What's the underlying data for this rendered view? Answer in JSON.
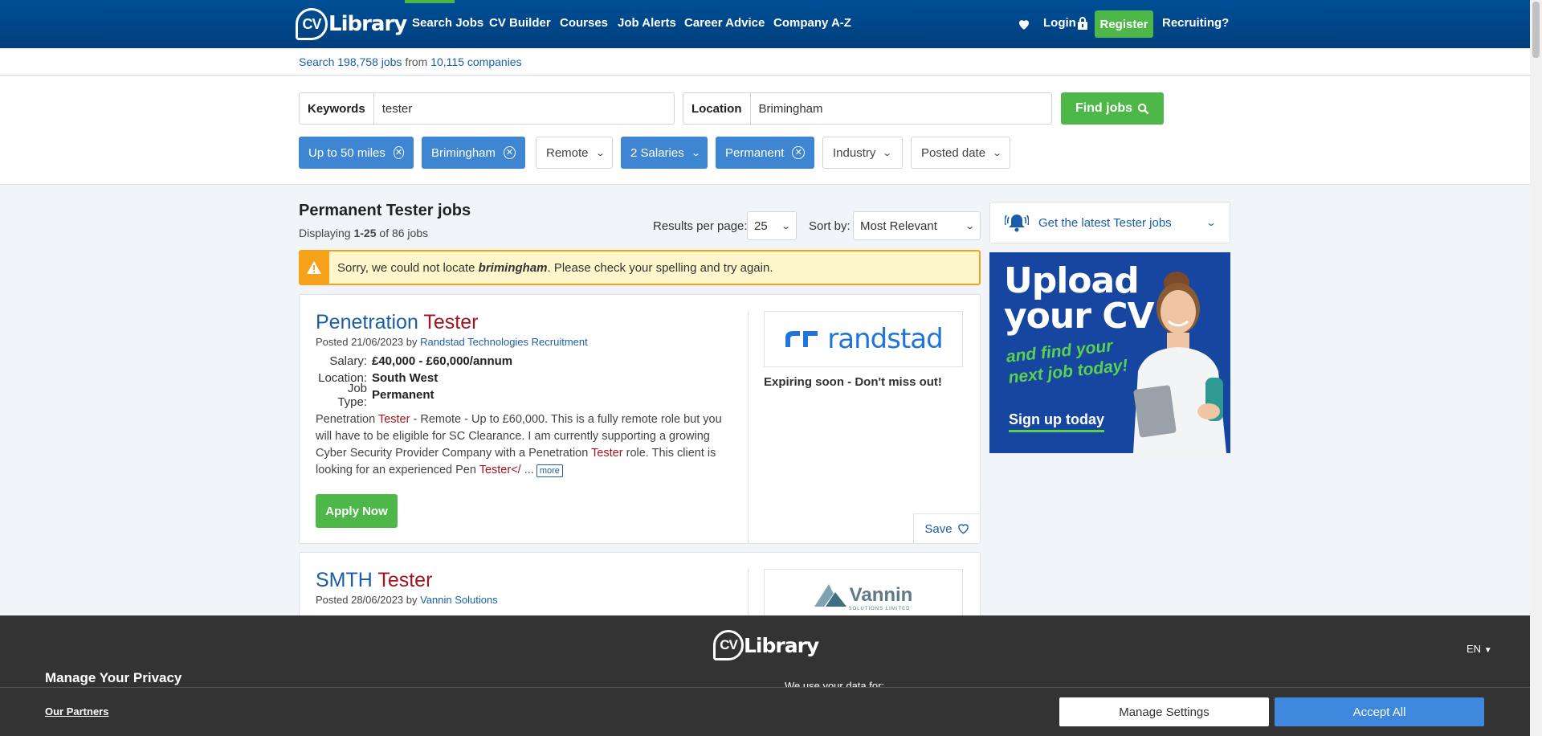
{
  "header": {
    "logo_cv": "CV",
    "logo_text": "Library",
    "nav": [
      "Search Jobs",
      "CV Builder",
      "Courses",
      "Job Alerts",
      "Career Advice",
      "Company A-Z"
    ],
    "login": "Login",
    "register": "Register",
    "recruiting": "Recruiting?"
  },
  "stats": {
    "prefix": "Search",
    "jobs_count": "198,758",
    "jobs_word": "jobs",
    "from": "from",
    "companies_count": "10,115",
    "companies_word": "companies"
  },
  "search": {
    "keywords_label": "Keywords",
    "keywords_value": "tester",
    "location_label": "Location",
    "location_value": "Brimingham",
    "find_label": "Find jobs"
  },
  "filters": [
    {
      "label": "Up to 50 miles",
      "active": true
    },
    {
      "label": "Brimingham",
      "active": true
    },
    {
      "label": "Remote",
      "active": false
    },
    {
      "label": "2 Salaries",
      "active": true
    },
    {
      "label": "Permanent",
      "active": true
    },
    {
      "label": "Industry",
      "active": false
    },
    {
      "label": "Posted date",
      "active": false
    }
  ],
  "results": {
    "title": "Permanent Tester jobs",
    "displaying": "Displaying",
    "range": "1-25",
    "of": "of 86 jobs",
    "per_page_label": "Results per page:",
    "per_page_value": "25",
    "sort_label": "Sort by:",
    "sort_value": "Most Relevant"
  },
  "alert": {
    "pre": "Sorry, we could not locate",
    "term": "brimingham",
    "post": ". Please check your spelling and try again."
  },
  "jobs": [
    {
      "title_a": "Penetration",
      "title_b": "Tester",
      "posted": "Posted 21/06/2023 by",
      "company": "Randstad Technologies Recruitment",
      "salary_k": "Salary:",
      "salary": "£40,000 - £60,000/annum",
      "location_k": "Location:",
      "location": "South West",
      "type_k": "Job Type:",
      "type": "Permanent",
      "desc_1": "Penetration",
      "desc_2": "Tester",
      "desc_3": "- Remote - Up to £60,000. This is a fully remote role but you will have to be eligible for SC Clearance. I am currently supporting a growing Cyber Security Provider Company with a Penetration",
      "desc_4": "Tester",
      "desc_5": "role. This client is looking for an experienced Pen",
      "desc_6": "Tester</",
      "desc_7": "...",
      "more": "more",
      "apply": "Apply Now",
      "logo_name": "randstad",
      "expiring": "Expiring soon - Don't miss out!",
      "save": "Save"
    },
    {
      "title_a": "SMTH",
      "title_b": "Tester",
      "posted": "Posted 28/06/2023 by",
      "company": "Vannin Solutions",
      "logo_name": "Vannin",
      "logo_sub": "SOLUTIONS LIMITED"
    }
  ],
  "sidebar": {
    "alert_pre": "Get the latest",
    "alert_term": "Tester",
    "alert_post": "jobs",
    "banner_h1": "Upload",
    "banner_h2": "your CV",
    "banner_s1": "and find your",
    "banner_s2": "next job today!",
    "banner_cta": "Sign up today"
  },
  "privacy": {
    "title": "Manage Your Privacy",
    "use_text": "We use your data for:",
    "lang": "EN",
    "partners": "Our Partners",
    "manage": "Manage Settings",
    "accept": "Accept All"
  },
  "colors": {
    "brand_blue": "#004f96",
    "green": "#4db848",
    "chip_active": "#3e86d1",
    "highlight_red": "#a3141e",
    "warning": "#f7a21b"
  }
}
